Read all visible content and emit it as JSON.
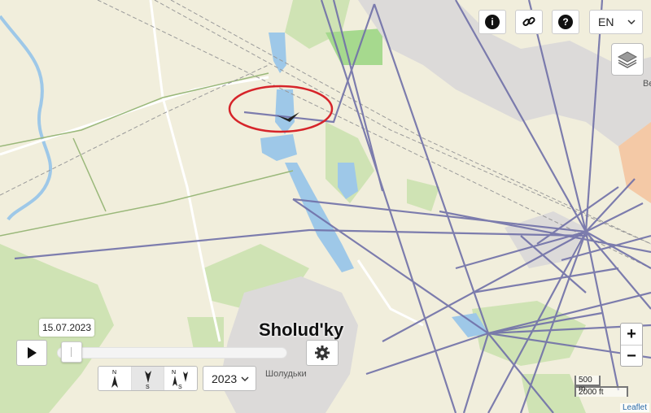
{
  "header": {
    "info_icon": "info-icon",
    "link_icon": "link-icon",
    "help_icon": "help-icon",
    "language": "EN"
  },
  "map": {
    "town_label": "Sholud'ky",
    "town_label_local": "Шолудьки",
    "edge_label": "Be",
    "highlight_color": "#d6242a",
    "track_color": "#7070a8"
  },
  "timeline": {
    "date": "15.07.2023",
    "progress": 0.02,
    "year": "2023"
  },
  "compass": {
    "modes": [
      {
        "top": "N",
        "bottom": ""
      },
      {
        "top": "",
        "bottom": "S"
      },
      {
        "top": "N",
        "bottom": "S"
      }
    ]
  },
  "scale": {
    "metric": "500 m",
    "imperial": "2000 ft"
  },
  "zoom": {
    "in": "+",
    "out": "−"
  },
  "attribution": "Leaflet"
}
